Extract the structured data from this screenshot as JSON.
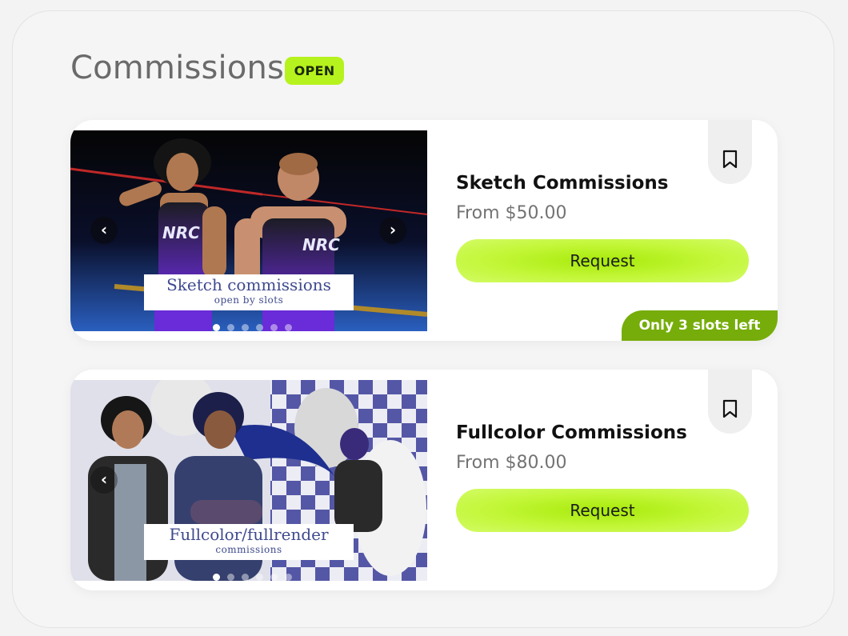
{
  "header": {
    "title": "Commissions",
    "status_badge": "OPEN"
  },
  "colors": {
    "accent_lime": "#b6f21d",
    "slots_green": "#76ad0a",
    "caption_blue": "#3f4a8e"
  },
  "commissions": [
    {
      "title": "Sketch Commissions",
      "price": "From $50.00",
      "request_label": "Request",
      "image_caption_line1": "Sketch commissions",
      "image_caption_line2": "open by slots",
      "slots_label": "Only 3 slots left",
      "carousel_prev": "‹",
      "carousel_next": "›",
      "carousel_slide_count": 6,
      "carousel_active_index": 0
    },
    {
      "title": "Fullcolor Commissions",
      "price": "From $80.00",
      "request_label": "Request",
      "image_caption_line1": "Fullcolor/fullrender",
      "image_caption_line2": "commissions",
      "carousel_prev": "‹",
      "carousel_slide_count": 6,
      "carousel_active_index": 0
    }
  ]
}
